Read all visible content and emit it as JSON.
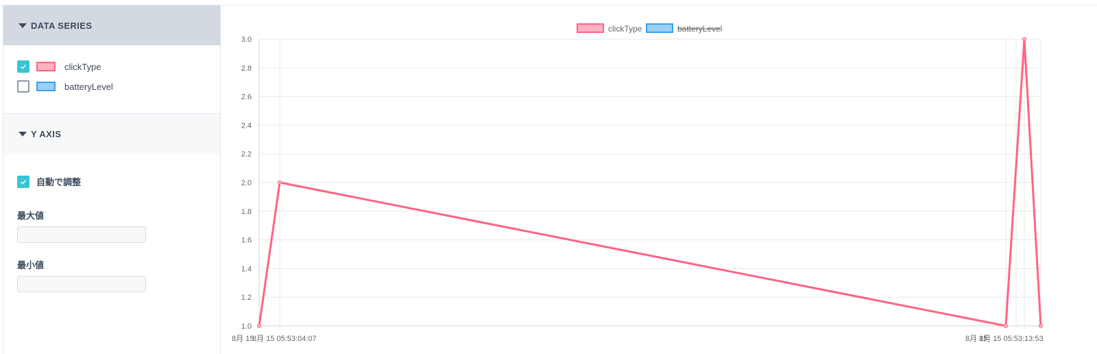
{
  "sidebar": {
    "data_series": {
      "header": "DATA SERIES",
      "items": [
        {
          "label": "clickType",
          "checked": true,
          "color": "#ff6384"
        },
        {
          "label": "batteryLevel",
          "checked": false,
          "color": "#36a2eb"
        }
      ]
    },
    "y_axis": {
      "header": "Y AXIS",
      "auto_label": "自動で調整",
      "auto_checked": true,
      "max_label": "最大値",
      "max_value": "",
      "min_label": "最小値",
      "min_value": ""
    }
  },
  "chart_data": {
    "type": "line",
    "title": "",
    "xlabel": "",
    "ylabel": "",
    "ylim": [
      1.0,
      3.0
    ],
    "y_ticks": [
      "3.0",
      "2.8",
      "2.6",
      "2.4",
      "2.2",
      "2.0",
      "1.8",
      "1.6",
      "1.4",
      "1.2",
      "1.0"
    ],
    "x_tick_labels": [
      "8月 15",
      "8月 15 05:53:04:07",
      "8月 15 05:53:13:53"
    ],
    "legend": {
      "position": "top-center"
    },
    "series": [
      {
        "name": "clickType",
        "visible": true,
        "color": "#ff6384",
        "values": [
          1.0,
          2.0,
          1.0,
          3.0,
          1.0
        ]
      },
      {
        "name": "batteryLevel",
        "visible": false,
        "color": "#36a2eb",
        "values": []
      }
    ]
  }
}
